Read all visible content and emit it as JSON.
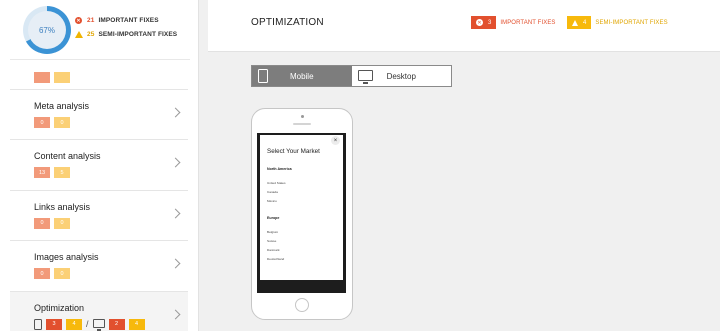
{
  "summary": {
    "score": "67%",
    "important_count": "21",
    "important_label": "IMPORTANT FIXES",
    "semi_count": "25",
    "semi_label": "SEMI-IMPORTANT FIXES",
    "score_fraction": 0.67
  },
  "sidebar": {
    "items": [
      {
        "title": "Meta analysis",
        "important": "0",
        "semi": "0"
      },
      {
        "title": "Content analysis",
        "important": "13",
        "semi": "5"
      },
      {
        "title": "Links analysis",
        "important": "0",
        "semi": "0"
      },
      {
        "title": "Images analysis",
        "important": "0",
        "semi": "0"
      },
      {
        "title": "Optimization",
        "mobile_important": "3",
        "mobile_semi": "4",
        "desktop_important": "2",
        "desktop_semi": "4"
      }
    ]
  },
  "header": {
    "title": "OPTIMIZATION",
    "important_count": "3",
    "important_label": "IMPORTANT FIXES",
    "semi_count": "4",
    "semi_label": "SEMI-IMPORTANT FIXES"
  },
  "view_toggle": {
    "mobile": "Mobile",
    "desktop": "Desktop",
    "selected": "Mobile"
  },
  "preview": {
    "modal_title": "Select Your Market",
    "close": "×",
    "regions": [
      {
        "name": "North America",
        "countries": [
          "United States",
          "Canada",
          "México"
        ]
      },
      {
        "name": "Europe",
        "countries": [
          "Belgium",
          "Suisse",
          "Danmark",
          "Deutschland"
        ]
      }
    ]
  },
  "colors": {
    "important": "#e2502e",
    "semi": "#f7b90c",
    "accent": "#3b93d5",
    "toggle_active": "#7d7d7d"
  }
}
